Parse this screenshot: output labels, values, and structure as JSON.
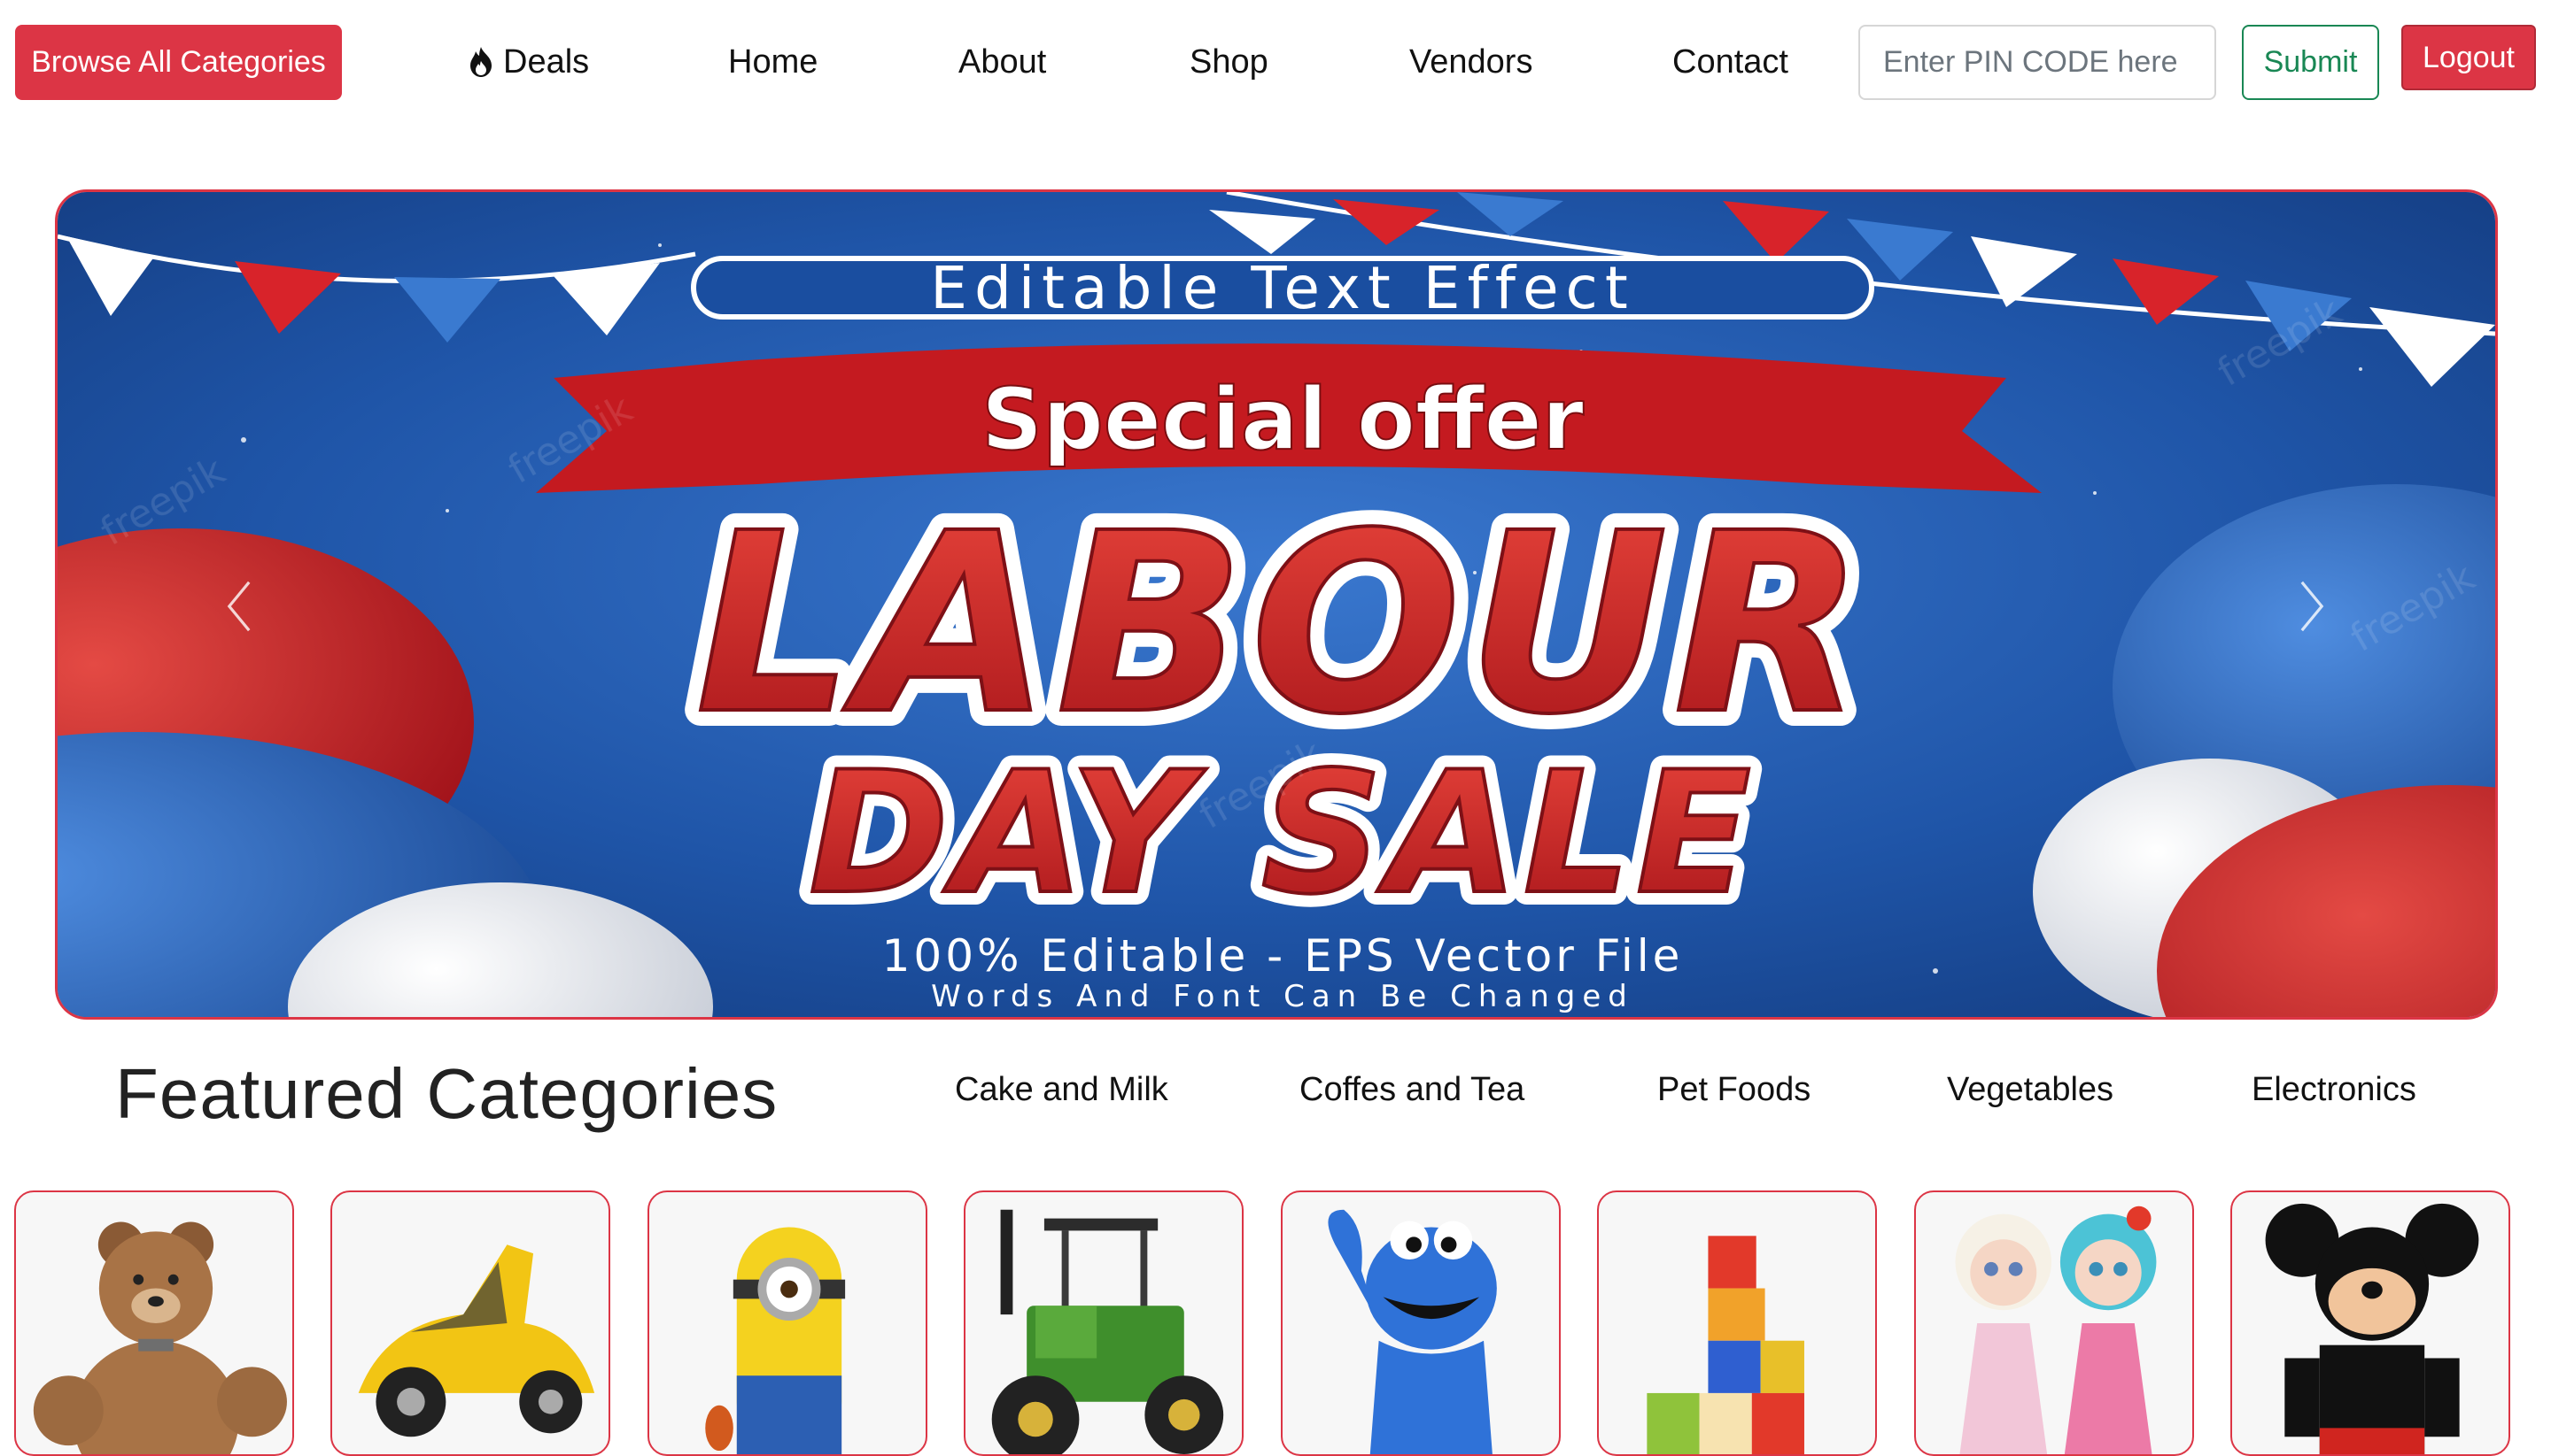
{
  "nav": {
    "browse_label": "Browse All Categories",
    "links": [
      {
        "label": "Deals",
        "icon": "flame-icon"
      },
      {
        "label": "Home"
      },
      {
        "label": "About"
      },
      {
        "label": "Shop"
      },
      {
        "label": "Vendors"
      },
      {
        "label": "Contact"
      }
    ],
    "pin_placeholder": "Enter PIN CODE here",
    "submit_label": "Submit",
    "logout_label": "Logout"
  },
  "banner": {
    "top_text": "Editable Text Effect",
    "ribbon_text": "Special offer",
    "line1": "LABOUR",
    "line2": "DAY SALE",
    "footer1": "100% Editable - EPS Vector File",
    "footer2": "Words And Font Can Be Changed",
    "watermark": "freepik",
    "prev_icon": "chevron-left-icon",
    "next_icon": "chevron-right-icon"
  },
  "featured": {
    "title": "Featured Categories",
    "tabs": [
      "Cake and Milk",
      "Coffes and Tea",
      "Pet Foods",
      "Vegetables",
      "Electronics"
    ],
    "cards": [
      {
        "icon": "teddy-bear-icon"
      },
      {
        "icon": "toy-car-icon"
      },
      {
        "icon": "minion-toy-icon"
      },
      {
        "icon": "toy-tractor-icon"
      },
      {
        "icon": "cookie-monster-toy-icon"
      },
      {
        "icon": "abc-blocks-icon"
      },
      {
        "icon": "dolls-icon"
      },
      {
        "icon": "mickey-toy-icon"
      }
    ]
  },
  "colors": {
    "accent_red": "#dc3545",
    "success_green": "#198754",
    "banner_blue": "#1f55a8"
  }
}
